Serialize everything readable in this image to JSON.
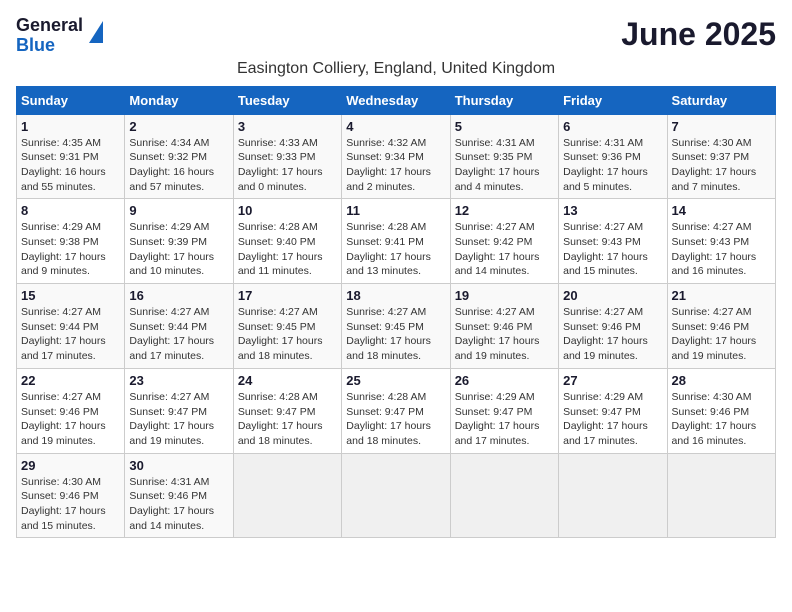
{
  "header": {
    "logo_line1": "General",
    "logo_line2": "Blue",
    "month": "June 2025",
    "location": "Easington Colliery, England, United Kingdom"
  },
  "weekdays": [
    "Sunday",
    "Monday",
    "Tuesday",
    "Wednesday",
    "Thursday",
    "Friday",
    "Saturday"
  ],
  "weeks": [
    [
      {
        "day": "1",
        "info": "Sunrise: 4:35 AM\nSunset: 9:31 PM\nDaylight: 16 hours\nand 55 minutes."
      },
      {
        "day": "2",
        "info": "Sunrise: 4:34 AM\nSunset: 9:32 PM\nDaylight: 16 hours\nand 57 minutes."
      },
      {
        "day": "3",
        "info": "Sunrise: 4:33 AM\nSunset: 9:33 PM\nDaylight: 17 hours\nand 0 minutes."
      },
      {
        "day": "4",
        "info": "Sunrise: 4:32 AM\nSunset: 9:34 PM\nDaylight: 17 hours\nand 2 minutes."
      },
      {
        "day": "5",
        "info": "Sunrise: 4:31 AM\nSunset: 9:35 PM\nDaylight: 17 hours\nand 4 minutes."
      },
      {
        "day": "6",
        "info": "Sunrise: 4:31 AM\nSunset: 9:36 PM\nDaylight: 17 hours\nand 5 minutes."
      },
      {
        "day": "7",
        "info": "Sunrise: 4:30 AM\nSunset: 9:37 PM\nDaylight: 17 hours\nand 7 minutes."
      }
    ],
    [
      {
        "day": "8",
        "info": "Sunrise: 4:29 AM\nSunset: 9:38 PM\nDaylight: 17 hours\nand 9 minutes."
      },
      {
        "day": "9",
        "info": "Sunrise: 4:29 AM\nSunset: 9:39 PM\nDaylight: 17 hours\nand 10 minutes."
      },
      {
        "day": "10",
        "info": "Sunrise: 4:28 AM\nSunset: 9:40 PM\nDaylight: 17 hours\nand 11 minutes."
      },
      {
        "day": "11",
        "info": "Sunrise: 4:28 AM\nSunset: 9:41 PM\nDaylight: 17 hours\nand 13 minutes."
      },
      {
        "day": "12",
        "info": "Sunrise: 4:27 AM\nSunset: 9:42 PM\nDaylight: 17 hours\nand 14 minutes."
      },
      {
        "day": "13",
        "info": "Sunrise: 4:27 AM\nSunset: 9:43 PM\nDaylight: 17 hours\nand 15 minutes."
      },
      {
        "day": "14",
        "info": "Sunrise: 4:27 AM\nSunset: 9:43 PM\nDaylight: 17 hours\nand 16 minutes."
      }
    ],
    [
      {
        "day": "15",
        "info": "Sunrise: 4:27 AM\nSunset: 9:44 PM\nDaylight: 17 hours\nand 17 minutes."
      },
      {
        "day": "16",
        "info": "Sunrise: 4:27 AM\nSunset: 9:44 PM\nDaylight: 17 hours\nand 17 minutes."
      },
      {
        "day": "17",
        "info": "Sunrise: 4:27 AM\nSunset: 9:45 PM\nDaylight: 17 hours\nand 18 minutes."
      },
      {
        "day": "18",
        "info": "Sunrise: 4:27 AM\nSunset: 9:45 PM\nDaylight: 17 hours\nand 18 minutes."
      },
      {
        "day": "19",
        "info": "Sunrise: 4:27 AM\nSunset: 9:46 PM\nDaylight: 17 hours\nand 19 minutes."
      },
      {
        "day": "20",
        "info": "Sunrise: 4:27 AM\nSunset: 9:46 PM\nDaylight: 17 hours\nand 19 minutes."
      },
      {
        "day": "21",
        "info": "Sunrise: 4:27 AM\nSunset: 9:46 PM\nDaylight: 17 hours\nand 19 minutes."
      }
    ],
    [
      {
        "day": "22",
        "info": "Sunrise: 4:27 AM\nSunset: 9:46 PM\nDaylight: 17 hours\nand 19 minutes."
      },
      {
        "day": "23",
        "info": "Sunrise: 4:27 AM\nSunset: 9:47 PM\nDaylight: 17 hours\nand 19 minutes."
      },
      {
        "day": "24",
        "info": "Sunrise: 4:28 AM\nSunset: 9:47 PM\nDaylight: 17 hours\nand 18 minutes."
      },
      {
        "day": "25",
        "info": "Sunrise: 4:28 AM\nSunset: 9:47 PM\nDaylight: 17 hours\nand 18 minutes."
      },
      {
        "day": "26",
        "info": "Sunrise: 4:29 AM\nSunset: 9:47 PM\nDaylight: 17 hours\nand 17 minutes."
      },
      {
        "day": "27",
        "info": "Sunrise: 4:29 AM\nSunset: 9:47 PM\nDaylight: 17 hours\nand 17 minutes."
      },
      {
        "day": "28",
        "info": "Sunrise: 4:30 AM\nSunset: 9:46 PM\nDaylight: 17 hours\nand 16 minutes."
      }
    ],
    [
      {
        "day": "29",
        "info": "Sunrise: 4:30 AM\nSunset: 9:46 PM\nDaylight: 17 hours\nand 15 minutes."
      },
      {
        "day": "30",
        "info": "Sunrise: 4:31 AM\nSunset: 9:46 PM\nDaylight: 17 hours\nand 14 minutes."
      },
      {
        "day": "",
        "info": ""
      },
      {
        "day": "",
        "info": ""
      },
      {
        "day": "",
        "info": ""
      },
      {
        "day": "",
        "info": ""
      },
      {
        "day": "",
        "info": ""
      }
    ]
  ]
}
